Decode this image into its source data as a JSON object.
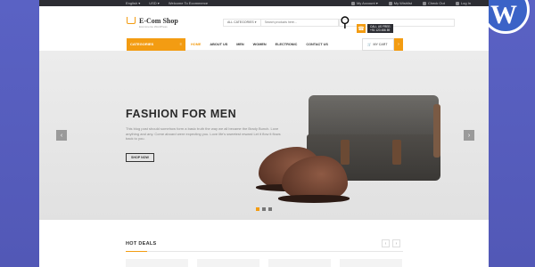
{
  "topbar": {
    "language": "English ▾",
    "currency": "USD ▾",
    "welcome": "Welcome To Ecommerce",
    "my_account": "My Account ▾",
    "wishlist": "My Wishlist",
    "checkout": "Check Out",
    "login": "Log In"
  },
  "logo": {
    "name": "E-Com Shop",
    "tagline": "Ecommerce WordPress"
  },
  "search": {
    "category": "ALL CATEGORIES ▾",
    "placeholder": "Search products here...",
    "button_icon": "search-icon"
  },
  "phone": {
    "label": "CALL US FREE:",
    "number": "+91 123 456 89"
  },
  "nav": {
    "categories_label": "CATEGORIES",
    "menu": [
      "HOME",
      "ABOUT US",
      "MEN",
      "WOMEN",
      "ELECTRONIC",
      "CONTACT US"
    ],
    "active_index": 0,
    "cart_label": "MY CART"
  },
  "hero": {
    "title": "FASHION FOR MEN",
    "description": "This blog post should somehow form a basic truth the way we all became the Brady Bunch. Love anything and any. Come aboard were expecting you. Love life's sweetest reward Let it flow it flows back to you.",
    "button": "SHOP NOW",
    "prev": "‹",
    "next": "›",
    "slides": 3,
    "active_slide": 1
  },
  "deals": {
    "title": "HOT DEALS",
    "prev": "‹",
    "next": "›"
  },
  "colors": {
    "accent": "#f39c12",
    "dark": "#2c2d33",
    "backdrop": "#5b5fbf"
  }
}
